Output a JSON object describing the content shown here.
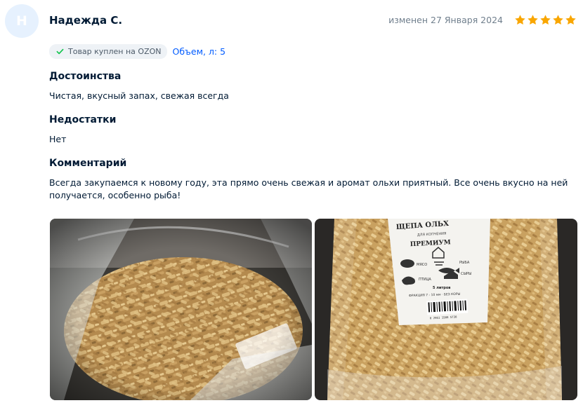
{
  "review": {
    "avatar_initial": "Н",
    "author": "Надежда С.",
    "edited": "изменен 27 Января 2024",
    "rating": 5,
    "purchased_badge": "Товар куплен на OZON",
    "variant": "Объем, л: 5",
    "pros_title": "Достоинства",
    "pros_text": "Чистая, вкусный запах, свежая всегда",
    "cons_title": "Недостатки",
    "cons_text": "Нет",
    "comment_title": "Комментарий",
    "comment_line1": "Всегда закупаемся к новому году, эта прямо очень свежая и аромат ольхи приятный. Все очень вкусно на ней",
    "comment_line2": "получается, особенно рыба!"
  },
  "photos": [
    {
      "icon": "photo-wood-chips-open-bag"
    },
    {
      "icon": "photo-wood-chips-package",
      "label_title": "ЩЕПА ОЛЬХ",
      "label_sub": "ДЛЯ КОПЧЕНИЯ",
      "label_brand": "ПРЕМИУМ",
      "label_meat": "МЯСО",
      "label_fish": "РЫБА",
      "label_bird": "ПТИЦА",
      "label_cheese": "СЫРЫ",
      "label_volume": "5 литров",
      "label_fraction": "ФРАКЦИЯ 7 - 10 мм · БЕЗ КОРЫ",
      "label_barcode": "0 2951 1588 5738"
    }
  ],
  "colors": {
    "star": "#f9a600",
    "link": "#005bff",
    "check": "#10c44c",
    "avatar_bg": "#e6f1fe"
  }
}
